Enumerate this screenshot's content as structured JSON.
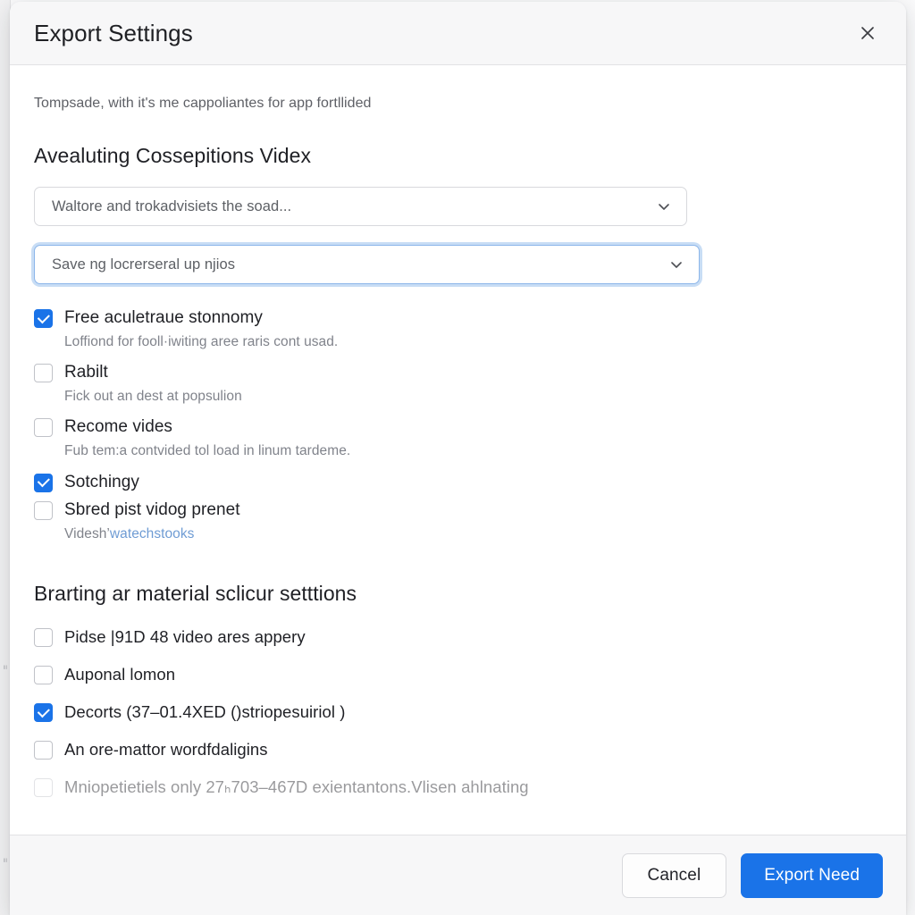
{
  "backdrop": {
    "rail_glyph_top": "≡",
    "rail_glyph_bottom": "≡"
  },
  "dialog": {
    "title": "Export Settings",
    "close_icon": "close-icon",
    "intro": "Tompsade, with it's me cappoliantes for app fortllided",
    "section_1": {
      "heading": "Avealuting Cossepitions Videx",
      "selects": [
        {
          "value": "Waltore and trokadvisiets the soad...",
          "chevron_icon": "chevron-down-icon",
          "focused": false
        },
        {
          "value": "Save ng locrerseral up njios",
          "chevron_icon": "chevron-down-icon",
          "focused": true
        }
      ],
      "options": [
        {
          "label": "Free aculetraue stonnomy",
          "description": "Loffiond for fooll·iwiting aree raris cont usad.",
          "checked": true
        },
        {
          "label": "Rabilt",
          "description": "Fick out an dest at popsulion",
          "checked": false
        },
        {
          "label": "Recome vides",
          "description": "Fub tem:a contvided tol load in linum tardeme.",
          "checked": false
        },
        {
          "label": "Sotchingy",
          "description": "",
          "checked": true
        },
        {
          "label": "Sbred pist vidog prenet",
          "description": "Videsh’",
          "description_link": "watechstooks",
          "checked": false
        }
      ]
    },
    "section_2": {
      "heading": "Brarting ar material sclicur setttions",
      "options": [
        {
          "label": "Pidse |91D 48 video ares appery",
          "checked": false,
          "faded": false
        },
        {
          "label": "Auponal lomon",
          "checked": false,
          "faded": false
        },
        {
          "label": "Decorts  (37–01.4XED ()striopesuiriol )",
          "checked": true,
          "faded": false
        },
        {
          "label": "An ore-mattor wordfdaligins",
          "checked": false,
          "faded": false
        },
        {
          "label": "Mniopetietiels only 27ₕ703–467D exientantons.Vlisen ahlnating",
          "checked": false,
          "faded": true
        }
      ]
    },
    "footer": {
      "cancel_label": "Cancel",
      "primary_label": "Export Need"
    }
  },
  "colors": {
    "accent": "#1a73e8",
    "header_bg": "#f7f7f8",
    "border": "#e2e2e5",
    "text_primary": "#1f2025",
    "text_muted": "#80838b",
    "link": "#6f9cd4",
    "focus_ring": "#8cb6ea"
  }
}
